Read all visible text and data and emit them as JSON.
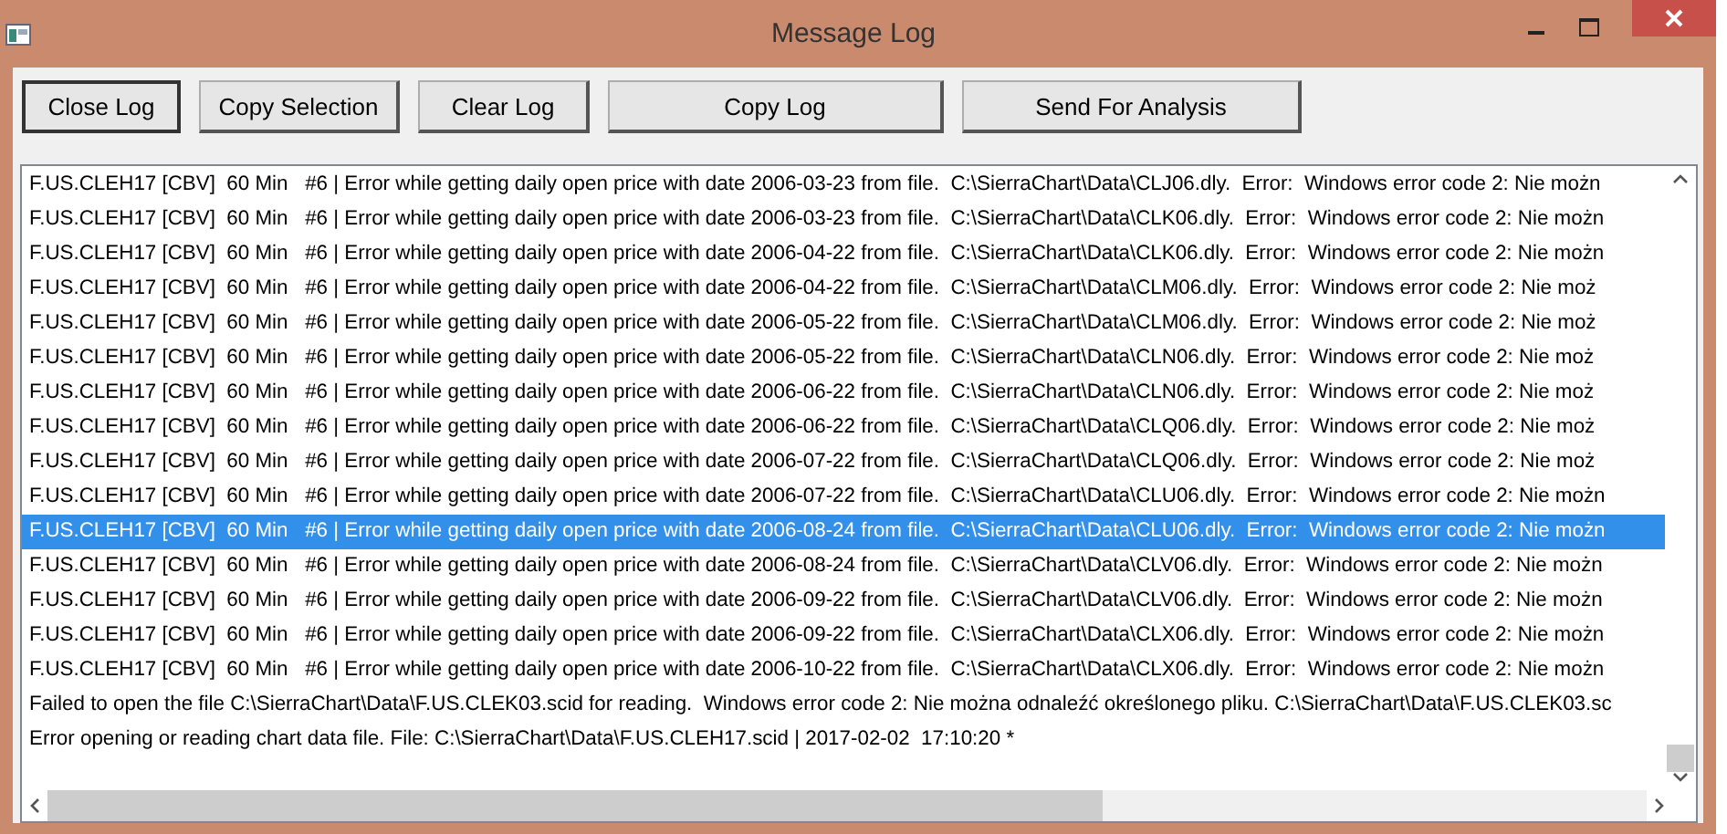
{
  "window": {
    "title": "Message Log"
  },
  "buttons": [
    "Close Log",
    "Copy Selection",
    "Clear Log",
    "Copy Log",
    "Send For Analysis"
  ],
  "log": [
    {
      "text": "F.US.CLEH17 [CBV]  60 Min   #6 | Error while getting daily open price with date 2006-03-23 from file.  C:\\SierraChart\\Data\\CLJ06.dly.  Error:  Windows error code 2: Nie możn",
      "selected": false
    },
    {
      "text": "F.US.CLEH17 [CBV]  60 Min   #6 | Error while getting daily open price with date 2006-03-23 from file.  C:\\SierraChart\\Data\\CLK06.dly.  Error:  Windows error code 2: Nie możn",
      "selected": false
    },
    {
      "text": "F.US.CLEH17 [CBV]  60 Min   #6 | Error while getting daily open price with date 2006-04-22 from file.  C:\\SierraChart\\Data\\CLK06.dly.  Error:  Windows error code 2: Nie możn",
      "selected": false
    },
    {
      "text": "F.US.CLEH17 [CBV]  60 Min   #6 | Error while getting daily open price with date 2006-04-22 from file.  C:\\SierraChart\\Data\\CLM06.dly.  Error:  Windows error code 2: Nie moż",
      "selected": false
    },
    {
      "text": "F.US.CLEH17 [CBV]  60 Min   #6 | Error while getting daily open price with date 2006-05-22 from file.  C:\\SierraChart\\Data\\CLM06.dly.  Error:  Windows error code 2: Nie moż",
      "selected": false
    },
    {
      "text": "F.US.CLEH17 [CBV]  60 Min   #6 | Error while getting daily open price with date 2006-05-22 from file.  C:\\SierraChart\\Data\\CLN06.dly.  Error:  Windows error code 2: Nie moż",
      "selected": false
    },
    {
      "text": "F.US.CLEH17 [CBV]  60 Min   #6 | Error while getting daily open price with date 2006-06-22 from file.  C:\\SierraChart\\Data\\CLN06.dly.  Error:  Windows error code 2: Nie moż",
      "selected": false
    },
    {
      "text": "F.US.CLEH17 [CBV]  60 Min   #6 | Error while getting daily open price with date 2006-06-22 from file.  C:\\SierraChart\\Data\\CLQ06.dly.  Error:  Windows error code 2: Nie moż",
      "selected": false
    },
    {
      "text": "F.US.CLEH17 [CBV]  60 Min   #6 | Error while getting daily open price with date 2006-07-22 from file.  C:\\SierraChart\\Data\\CLQ06.dly.  Error:  Windows error code 2: Nie moż",
      "selected": false
    },
    {
      "text": "F.US.CLEH17 [CBV]  60 Min   #6 | Error while getting daily open price with date 2006-07-22 from file.  C:\\SierraChart\\Data\\CLU06.dly.  Error:  Windows error code 2: Nie możn",
      "selected": false
    },
    {
      "text": "F.US.CLEH17 [CBV]  60 Min   #6 | Error while getting daily open price with date 2006-08-24 from file.  C:\\SierraChart\\Data\\CLU06.dly.  Error:  Windows error code 2: Nie możn",
      "selected": true
    },
    {
      "text": "F.US.CLEH17 [CBV]  60 Min   #6 | Error while getting daily open price with date 2006-08-24 from file.  C:\\SierraChart\\Data\\CLV06.dly.  Error:  Windows error code 2: Nie możn",
      "selected": false
    },
    {
      "text": "F.US.CLEH17 [CBV]  60 Min   #6 | Error while getting daily open price with date 2006-09-22 from file.  C:\\SierraChart\\Data\\CLV06.dly.  Error:  Windows error code 2: Nie możn",
      "selected": false
    },
    {
      "text": "F.US.CLEH17 [CBV]  60 Min   #6 | Error while getting daily open price with date 2006-09-22 from file.  C:\\SierraChart\\Data\\CLX06.dly.  Error:  Windows error code 2: Nie możn",
      "selected": false
    },
    {
      "text": "F.US.CLEH17 [CBV]  60 Min   #6 | Error while getting daily open price with date 2006-10-22 from file.  C:\\SierraChart\\Data\\CLX06.dly.  Error:  Windows error code 2: Nie możn",
      "selected": false
    },
    {
      "text": "Failed to open the file C:\\SierraChart\\Data\\F.US.CLEK03.scid for reading.  Windows error code 2: Nie można odnaleźć określonego pliku. C:\\SierraChart\\Data\\F.US.CLEK03.sc",
      "selected": false
    },
    {
      "text": "Error opening or reading chart data file. File: C:\\SierraChart\\Data\\F.US.CLEH17.scid | 2017-02-02  17:10:20 *",
      "selected": false
    }
  ]
}
